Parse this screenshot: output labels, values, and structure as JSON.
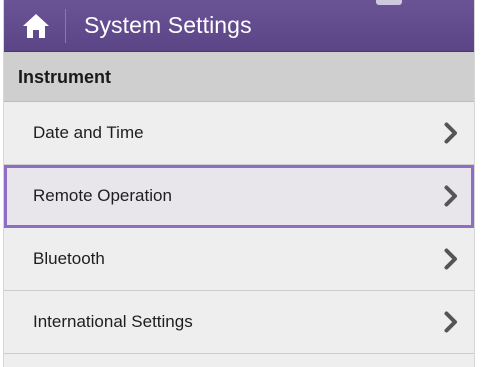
{
  "header": {
    "title": "System Settings",
    "home_icon": "home-icon"
  },
  "section": {
    "label": "Instrument"
  },
  "items": [
    {
      "label": "Date and Time",
      "icon": "chevron-right-icon",
      "selected": false
    },
    {
      "label": "Remote Operation",
      "icon": "chevron-right-icon",
      "selected": true
    },
    {
      "label": "Bluetooth",
      "icon": "chevron-right-icon",
      "selected": false
    },
    {
      "label": "International Settings",
      "icon": "chevron-right-icon",
      "selected": false
    }
  ],
  "colors": {
    "titlebar": "#5f4a8c",
    "selection_outline": "#8d6ec4",
    "section_header": "#cfcfcf",
    "list_background": "#eeeeee"
  }
}
